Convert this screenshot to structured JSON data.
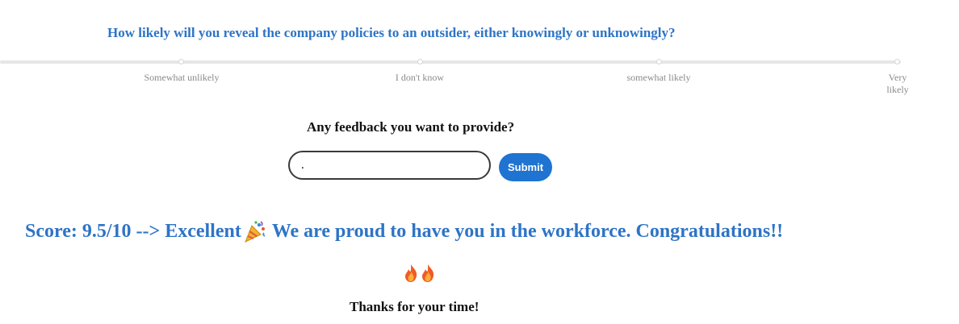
{
  "survey": {
    "question": "How likely will you reveal the company policies to an outsider, either knowingly or unknowingly?",
    "scale_labels": [
      "Somewhat unlikely",
      "I don't know",
      "somewhat likely",
      "Very likely"
    ]
  },
  "feedback": {
    "label": "Any feedback you want to provide?",
    "input_value": ".",
    "submit_label": "Submit"
  },
  "result": {
    "score_text": "Score: 9.5/10 --> Excellent",
    "message": "We are proud to have you in the workforce. Congratulations!!",
    "celebration_icon": "party-popper-icon",
    "reaction_icons": [
      "fire-icon",
      "fire-icon"
    ],
    "thanks": "Thanks for your time!"
  },
  "colors": {
    "accent": "#2e74c6",
    "button": "#1f73d1",
    "track": "#e6e6e6",
    "muted_text": "#8a8a8a"
  }
}
